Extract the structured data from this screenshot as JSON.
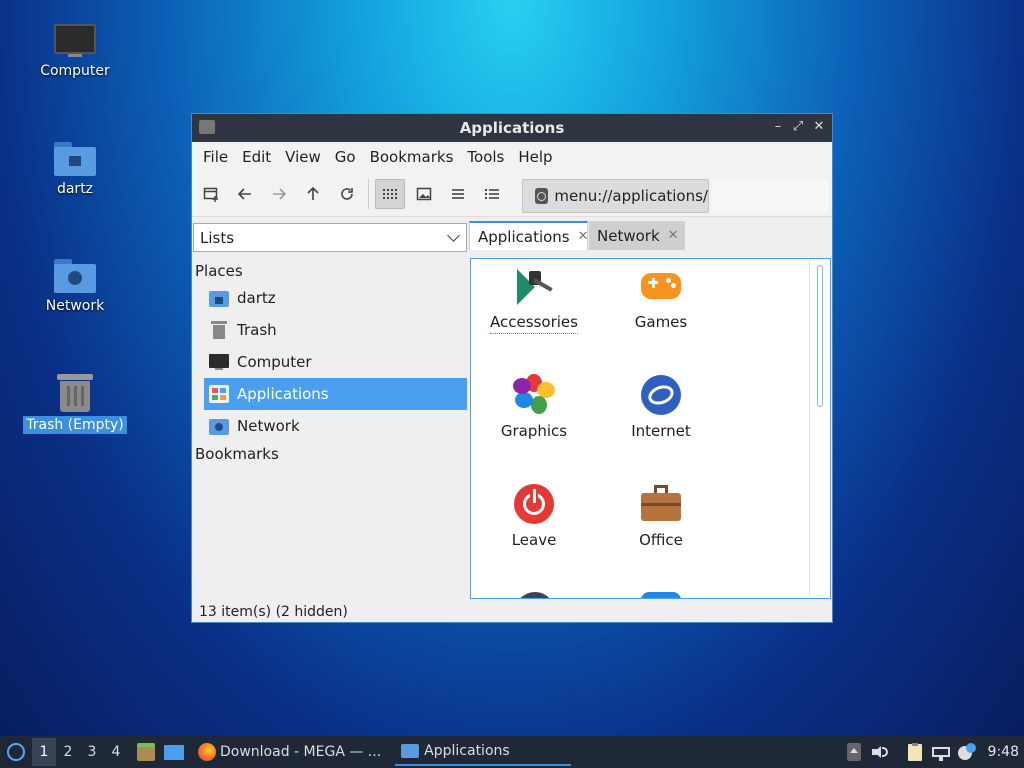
{
  "desktop": {
    "icons": [
      {
        "label": "Computer",
        "icon": "monitor-icon"
      },
      {
        "label": "dartz",
        "icon": "home-folder-icon"
      },
      {
        "label": "Network",
        "icon": "network-folder-icon"
      },
      {
        "label": "Trash (Empty)",
        "icon": "trash-icon",
        "selected": true
      }
    ]
  },
  "window": {
    "title": "Applications",
    "menu": [
      "File",
      "Edit",
      "View",
      "Go",
      "Bookmarks",
      "Tools",
      "Help"
    ],
    "location": "menu://applications/",
    "sidebar_mode": "Lists",
    "places_header": "Places",
    "places": [
      {
        "label": "dartz",
        "icon": "home-folder-icon"
      },
      {
        "label": "Trash",
        "icon": "trash-icon"
      },
      {
        "label": "Computer",
        "icon": "monitor-icon"
      },
      {
        "label": "Applications",
        "icon": "applications-icon",
        "active": true
      },
      {
        "label": "Network",
        "icon": "network-folder-icon"
      }
    ],
    "bookmarks_header": "Bookmarks",
    "tabs": [
      {
        "label": "Applications",
        "active": true
      },
      {
        "label": "Network",
        "active": false
      }
    ],
    "items": [
      {
        "label": "Accessories",
        "icon": "accessories-icon"
      },
      {
        "label": "Games",
        "icon": "gamepad-icon"
      },
      {
        "label": "Graphics",
        "icon": "graphics-icon"
      },
      {
        "label": "Internet",
        "icon": "internet-icon"
      },
      {
        "label": "Leave",
        "icon": "power-icon"
      },
      {
        "label": "Office",
        "icon": "briefcase-icon"
      }
    ],
    "status": "13 item(s) (2 hidden)"
  },
  "taskbar": {
    "workspaces": [
      "1",
      "2",
      "3",
      "4"
    ],
    "active_workspace": "1",
    "tasks": [
      {
        "label": "Download - MEGA — ...",
        "icon": "firefox-icon"
      },
      {
        "label": "Applications",
        "icon": "folder-icon",
        "active": true
      }
    ],
    "clock": "9:48"
  },
  "colors": {
    "accent": "#4a9ff0",
    "titlebar": "#2e3440",
    "taskbar": "#1f2836"
  }
}
